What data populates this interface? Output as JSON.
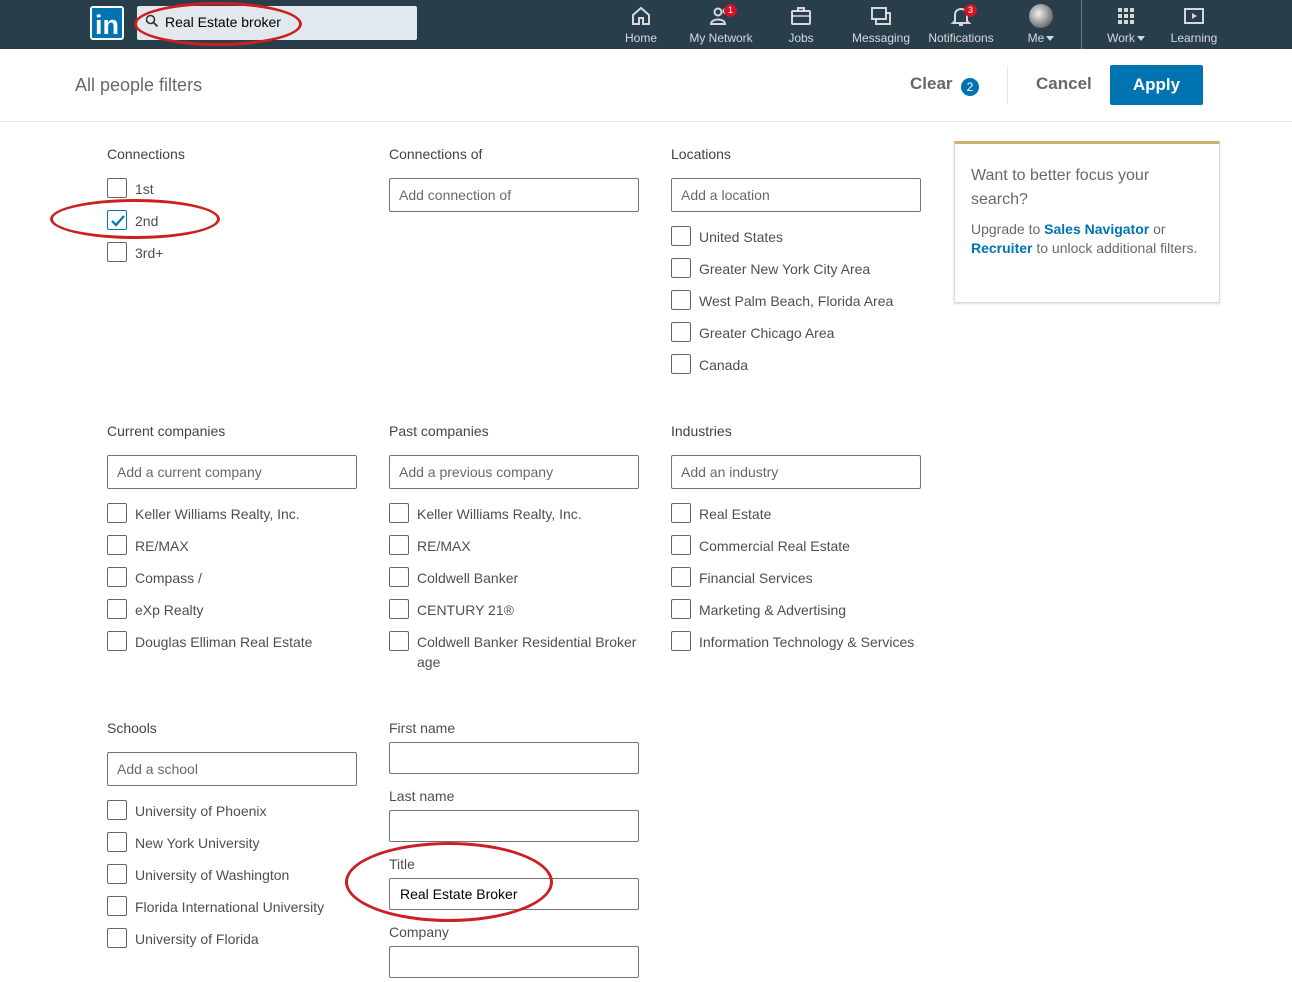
{
  "nav": {
    "logo": "in",
    "search_value": "Real Estate broker",
    "items": [
      {
        "label": "Home",
        "icon": "home-icon"
      },
      {
        "label": "My Network",
        "icon": "network-icon",
        "badge": "1"
      },
      {
        "label": "Jobs",
        "icon": "briefcase-icon"
      },
      {
        "label": "Messaging",
        "icon": "messaging-icon"
      },
      {
        "label": "Notifications",
        "icon": "bell-icon",
        "badge": "3"
      },
      {
        "label": "Me",
        "icon": "avatar"
      },
      {
        "label": "Work",
        "icon": "grid-icon"
      },
      {
        "label": "Learning",
        "icon": "learning-icon"
      }
    ]
  },
  "header": {
    "title": "All people filters",
    "clear_label": "Clear",
    "clear_count": "2",
    "cancel_label": "Cancel",
    "apply_label": "Apply"
  },
  "connections": {
    "title": "Connections",
    "options": [
      {
        "label": "1st",
        "checked": false
      },
      {
        "label": "2nd",
        "checked": true
      },
      {
        "label": "3rd+",
        "checked": false
      }
    ]
  },
  "connections_of": {
    "title": "Connections of",
    "placeholder": "Add connection of"
  },
  "locations": {
    "title": "Locations",
    "placeholder": "Add a location",
    "options": [
      "United States",
      "Greater New York City Area",
      "West Palm Beach, Florida Area",
      "Greater Chicago Area",
      "Canada"
    ]
  },
  "current_companies": {
    "title": "Current companies",
    "placeholder": "Add a current company",
    "options": [
      "Keller Williams Realty, Inc.",
      "RE/MAX",
      "Compass /",
      "eXp Realty",
      "Douglas Elliman Real Estate"
    ]
  },
  "past_companies": {
    "title": "Past companies",
    "placeholder": "Add a previous company",
    "options": [
      "Keller Williams Realty, Inc.",
      "RE/MAX",
      "Coldwell Banker",
      "CENTURY 21®",
      "Coldwell Banker Residential Brokerage"
    ]
  },
  "industries": {
    "title": "Industries",
    "placeholder": "Add an industry",
    "options": [
      "Real Estate",
      "Commercial Real Estate",
      "Financial Services",
      "Marketing & Advertising",
      "Information Technology & Services"
    ]
  },
  "schools": {
    "title": "Schools",
    "placeholder": "Add a school",
    "options": [
      "University of Phoenix",
      "New York University",
      "University of Washington",
      "Florida International University",
      "University of Florida"
    ]
  },
  "keywords": {
    "first_name_label": "First name",
    "first_name_value": "",
    "last_name_label": "Last name",
    "last_name_value": "",
    "title_label": "Title",
    "title_value": "Real Estate Broker",
    "company_label": "Company",
    "company_value": ""
  },
  "upsell": {
    "heading": "Want to better focus your search?",
    "text_prefix": "Upgrade to ",
    "link1": "Sales Navigator",
    "text_mid": " or ",
    "link2": "Recruiter",
    "text_suffix": " to unlock additional filters."
  },
  "colors": {
    "nav_bg": "#283e4a",
    "primary": "#0073b1",
    "highlight_ring": "#cc1f1f",
    "badge": "#d11124"
  }
}
